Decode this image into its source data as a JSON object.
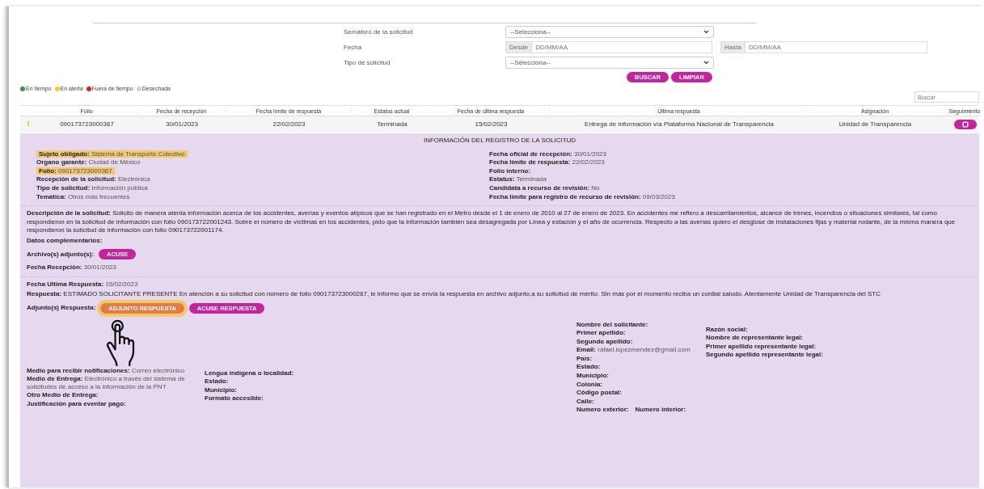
{
  "filters": {
    "semaforo": {
      "label": "Semáforo de la solicitud",
      "value": "--Selecciona--"
    },
    "fecha": {
      "label": "Fecha",
      "from": {
        "prefix": "Desde",
        "placeholder": "DD/MM/AA"
      },
      "to": {
        "prefix": "Hasta",
        "placeholder": "DD/MM/AA"
      }
    },
    "tipo": {
      "label": "Tipo de solicitud",
      "value": "--Selecciona--"
    },
    "buttons": [
      "BUSCAR",
      "LIMPIAR"
    ]
  },
  "legend": [
    {
      "label": "En tiempo",
      "color": "#2e9e3e"
    },
    {
      "label": "En alerta",
      "color": "#f2d21b"
    },
    {
      "label": "Fuera de tiempo",
      "color": "#d61f1f"
    },
    {
      "label": "Desechada",
      "color": "#d0d0d0"
    }
  ],
  "search": {
    "placeholder": "Buscar"
  },
  "table": {
    "columns": [
      "Folio",
      "Fecha de recepción",
      "Fecha límite de respuesta",
      "Estatus actual",
      "Fecha de última respuesta",
      "Última respuesta",
      "Asignación",
      "Seguimiento"
    ],
    "rows": [
      {
        "color": "#f2d21b",
        "cells": [
          "090173723000367",
          "30/01/2023",
          "22/02/2023",
          "Terminada",
          "15/02/2023",
          "Entrega de información vía Plataforma Nacional de Transparencia",
          "Unidad de Transparencia"
        ]
      }
    ]
  },
  "detail": {
    "title": "INFORMACIÓN DEL REGISTRO DE LA SOLICITUD",
    "left": [
      {
        "label": "Sujeto obligado:",
        "value": "Sistema de Transporte Colectivo",
        "highlighted": true
      },
      {
        "label": "Organo garante:",
        "value": "Ciudad de México",
        "highlighted": false
      },
      {
        "label": "Folio:",
        "value": "090173723000367",
        "highlighted": true
      },
      {
        "label": "Recepción de la solicitud:",
        "value": "Electrónica",
        "highlighted": false
      },
      {
        "label": "Tipo de solicitud:",
        "value": "Información pública",
        "highlighted": false
      },
      {
        "label": "Temática:",
        "value": "Otros más frecuentes",
        "highlighted": false
      }
    ],
    "right": [
      {
        "label": "Fecha oficial de recepción:",
        "value": "30/01/2023"
      },
      {
        "label": "Fecha límite de respuesta:",
        "value": "22/02/2023"
      },
      {
        "label": "Folio interno:"
      },
      {
        "label": "Estatus:",
        "value": "Terminada"
      },
      {
        "label": "Candidata a recurso de revisión:",
        "value": "No"
      },
      {
        "label": "Fecha límite para registro de recurso de revisión:",
        "value": "09/03/2023"
      }
    ],
    "description": "**Descripción de la solicitud:** Solicito de manera atenta información acerca de los accidentes, averías y eventos atípicos que se han registrado en el Metro desde el 1 de enero de 2010 al 27 de enero de 2023. En accidentes me refiero a descarrilamientos, alcance de trenes, incendios o situaciones similares, tal como respondieron en la solicitud de información con folio 090173722001243. Sobre el número de víctimas en los accidentes, pido que la información también sea desagregada por Línea y estación y el año de ocurrencia. Respecto a las averías quiero el desglose de instalaciones fijas y material rodante, de la misma manera que respondieron la solicitud de información con folio 090173722001174.",
    "complementary": "Datos complementarios:",
    "attachments": {
      "label": "Archivo(s) adjunto(s):",
      "buttons": [
        {
          "label": "ACUSE",
          "highlighted": false
        }
      ]
    },
    "received": {
      "label": "Fecha Recepción:",
      "value": "30/01/2023"
    },
    "last_response": {
      "label": "Fecha Ultima Respuesta:",
      "value": "15/02/2023"
    },
    "response": "**Respuesta:** ESTIMADO SOLICITANTE PRESENTE En atención a su solicitud con número de folio 090173723000267, le informo que se envía la respuesta en archivo adjunto,a su solicitud de mérito. Sin más por el momento reciba un cordial saludo. Atentamente Unidad de Transparencia del STC",
    "response_attachments": {
      "label": "Adjunto(s) Respuesta:",
      "buttons": [
        {
          "label": "ADJUNTO RESPUESTA",
          "highlighted": true
        },
        {
          "label": "ACUSE RESPUESTA",
          "highlighted": false
        }
      ]
    },
    "columns": [
      [
        {
          "label": "Medio para recibir notificaciones:",
          "value": "Correo electrónico"
        },
        {
          "label": "Medio de Entrega:",
          "value": "Electrónico a través del sistema de solicitudes de acceso a la información de la PNT"
        },
        {
          "label": "Otro Medio de Entrega:"
        },
        {
          "label": "Justificación para eventar pago:"
        }
      ],
      [
        {
          "label": "Lengua indígena o localidad:"
        },
        {
          "label": "Estado:"
        },
        {
          "label": "Municipio:"
        },
        {
          "label": "Formato accesible:"
        }
      ],
      [
        {
          "label": "Nombre del solicitante:"
        },
        {
          "label": "Primer apellido:"
        },
        {
          "label": "Segundo apellido:"
        },
        {
          "label": "Email:",
          "value": "rafael.lopezmendez@gmail.com"
        },
        {
          "label": "País:"
        },
        {
          "label": "Estado:"
        },
        {
          "label": "Municipio:"
        },
        {
          "label": "Colonia:"
        },
        {
          "label": "Código postal:"
        },
        {
          "label": "Calle:"
        },
        {
          "label": "Numero exterior:"
        },
        {
          "label": "Numero interior:"
        }
      ],
      [
        {
          "label": "Razón social:"
        },
        {
          "label": "Nombre de representante legal:"
        },
        {
          "label": "Primer apellido representante legal:"
        },
        {
          "label": "Segundo apellido representante legal:"
        }
      ]
    ]
  }
}
